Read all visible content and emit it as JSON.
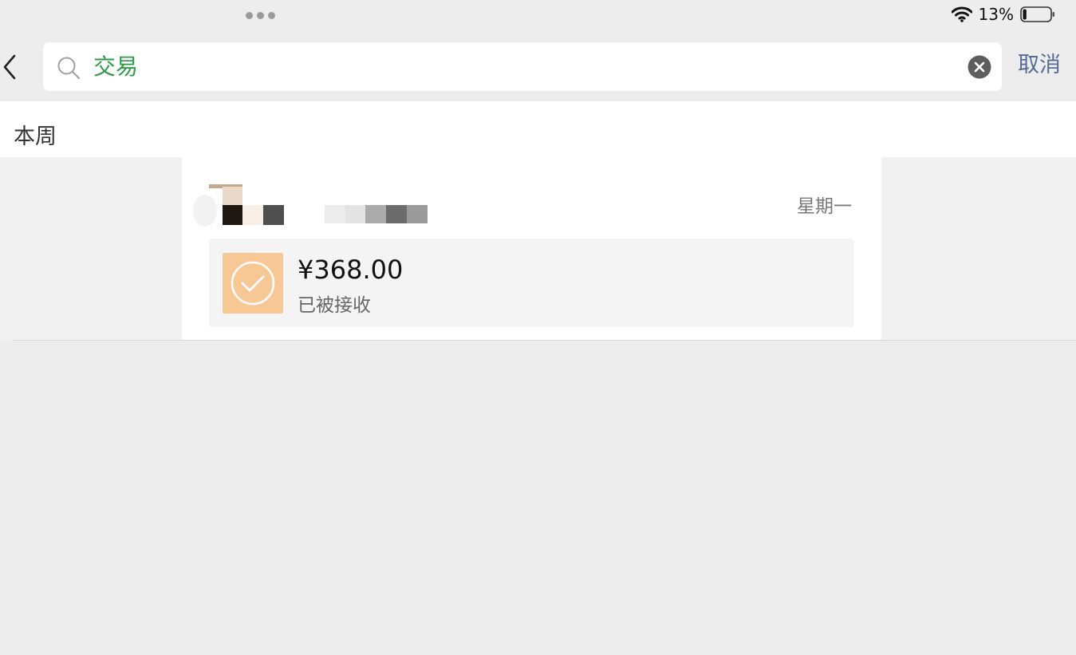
{
  "status_bar": {
    "battery_percent": "13%",
    "battery_level": 0.13
  },
  "search": {
    "query": "交易",
    "cancel_label": "取消"
  },
  "section": {
    "title": "本周"
  },
  "result": {
    "date": "星期一",
    "transfer": {
      "amount": "¥368.00",
      "status": "已被接收"
    }
  },
  "colors": {
    "search_text": "#2e9b45",
    "cancel": "#576b95",
    "transfer_icon_bg": "#f8c894"
  },
  "icons": [
    "wifi-icon",
    "battery-icon",
    "back-icon",
    "search-icon",
    "clear-icon",
    "check-icon"
  ]
}
